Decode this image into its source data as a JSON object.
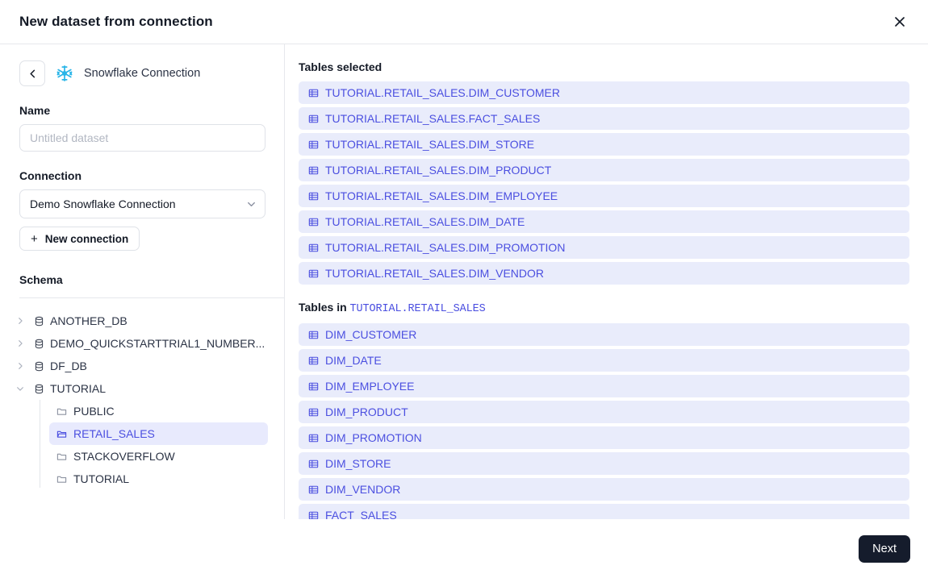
{
  "header": {
    "title": "New dataset from connection",
    "close_label": "×"
  },
  "sidebar": {
    "back_label": "‹",
    "connection_icon": "snowflake-icon",
    "connection_title": "Snowflake Connection",
    "name": {
      "label": "Name",
      "value": "",
      "placeholder": "Untitled dataset"
    },
    "connection": {
      "label": "Connection",
      "selected": "Demo Snowflake Connection"
    },
    "new_connection_label": "New connection",
    "schema_label": "Schema",
    "tree": [
      {
        "label": "ANOTHER_DB",
        "expanded": false,
        "icon": "database-icon"
      },
      {
        "label": "DEMO_QUICKSTARTTRIAL1_NUMBER...",
        "expanded": false,
        "icon": "database-icon"
      },
      {
        "label": "DF_DB",
        "expanded": false,
        "icon": "database-icon"
      },
      {
        "label": "TUTORIAL",
        "expanded": true,
        "icon": "database-icon"
      }
    ],
    "schemas": [
      {
        "label": "PUBLIC",
        "selected": false
      },
      {
        "label": "RETAIL_SALES",
        "selected": true
      },
      {
        "label": "STACKOVERFLOW",
        "selected": false
      },
      {
        "label": "TUTORIAL",
        "selected": false
      }
    ]
  },
  "main": {
    "selected_heading": "Tables selected",
    "selected_tables": [
      "TUTORIAL.RETAIL_SALES.DIM_CUSTOMER",
      "TUTORIAL.RETAIL_SALES.FACT_SALES",
      "TUTORIAL.RETAIL_SALES.DIM_STORE",
      "TUTORIAL.RETAIL_SALES.DIM_PRODUCT",
      "TUTORIAL.RETAIL_SALES.DIM_EMPLOYEE",
      "TUTORIAL.RETAIL_SALES.DIM_DATE",
      "TUTORIAL.RETAIL_SALES.DIM_PROMOTION",
      "TUTORIAL.RETAIL_SALES.DIM_VENDOR"
    ],
    "available_heading_prefix": "Tables in",
    "available_heading_path": "TUTORIAL.RETAIL_SALES",
    "available_tables": [
      "DIM_CUSTOMER",
      "DIM_DATE",
      "DIM_EMPLOYEE",
      "DIM_PRODUCT",
      "DIM_PROMOTION",
      "DIM_STORE",
      "DIM_VENDOR",
      "FACT_SALES"
    ]
  },
  "footer": {
    "next_label": "Next"
  },
  "colors": {
    "accent": "#4b4fe0",
    "row_background": "#e9ecfb",
    "selected_schema_background": "#e8eafd",
    "primary_button": "#151c2c",
    "snowflake_blue": "#29b5e8"
  }
}
